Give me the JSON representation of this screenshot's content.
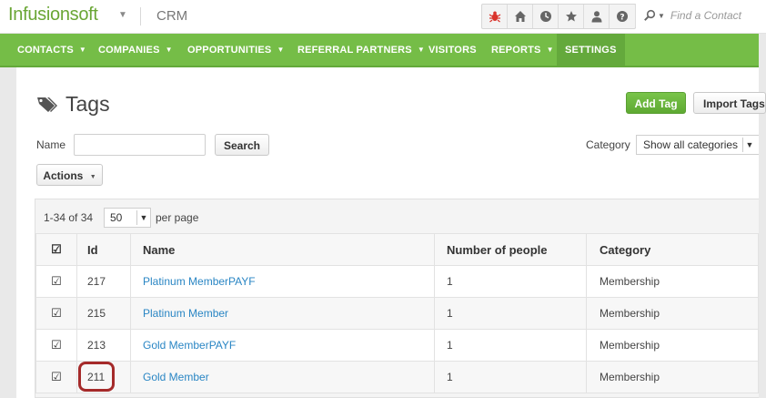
{
  "header": {
    "logo_text": "Infusionsoft",
    "app_name": "CRM",
    "search_placeholder": "Find a Contact",
    "toolbar_icons": [
      "bug-icon",
      "home-icon",
      "clock-icon",
      "star-icon",
      "person-icon",
      "help-icon"
    ]
  },
  "nav": {
    "items": [
      {
        "label": "CONTACTS",
        "has_caret": true
      },
      {
        "label": "COMPANIES",
        "has_caret": true
      },
      {
        "label": "OPPORTUNITIES",
        "has_caret": true
      },
      {
        "label": "REFERRAL PARTNERS",
        "has_caret": true
      },
      {
        "label": "VISITORS",
        "has_caret": false
      },
      {
        "label": "REPORTS",
        "has_caret": true
      },
      {
        "label": "SETTINGS",
        "has_caret": false,
        "active": true
      }
    ],
    "caret_glyph": "▼"
  },
  "page": {
    "title": "Tags",
    "add_tag_label": "Add Tag",
    "import_tags_label": "Import Tags",
    "name_label": "Name",
    "search_button_label": "Search",
    "category_label": "Category",
    "category_selected": "Show all categories",
    "actions_label": "Actions"
  },
  "pager": {
    "range_text": "1-34 of 34",
    "page_size": "50",
    "per_page_text": "per page"
  },
  "table": {
    "headers": {
      "id": "Id",
      "name": "Name",
      "number": "Number of people",
      "category": "Category"
    },
    "rows": [
      {
        "id": "217",
        "name": "Platinum MemberPAYF",
        "number": "1",
        "category": "Membership",
        "checked": true
      },
      {
        "id": "215",
        "name": "Platinum Member",
        "number": "1",
        "category": "Membership",
        "checked": true
      },
      {
        "id": "213",
        "name": "Gold MemberPAYF",
        "number": "1",
        "category": "Membership",
        "checked": true
      },
      {
        "id": "211",
        "name": "Gold Member",
        "number": "1",
        "category": "Membership",
        "checked": true
      }
    ]
  },
  "colors": {
    "brand_green": "#75bd47",
    "link_blue": "#2a86c4",
    "highlight_red": "#a52a2a"
  }
}
